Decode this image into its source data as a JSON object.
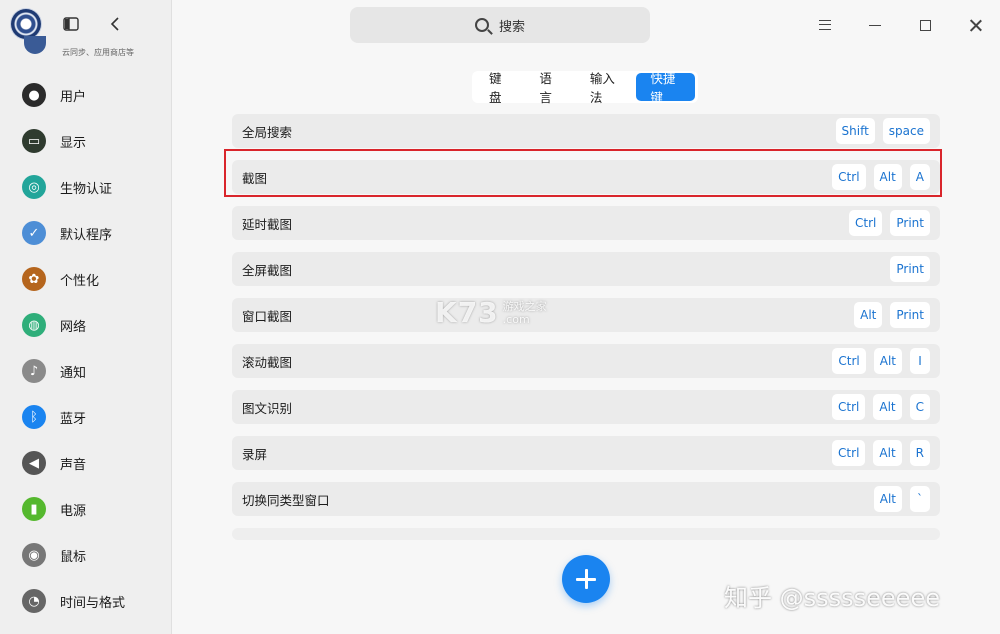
{
  "window": {
    "search_label": "搜索"
  },
  "sidebar": {
    "sync_caption": "云同步、应用商店等",
    "items": [
      {
        "label": "用户",
        "icon": "user-icon",
        "color": "#2b2b2b"
      },
      {
        "label": "显示",
        "icon": "monitor-icon",
        "color": "#2f3b2f"
      },
      {
        "label": "生物认证",
        "icon": "fingerprint-icon",
        "color": "#22a59a"
      },
      {
        "label": "默认程序",
        "icon": "default-apps-icon",
        "color": "#4d8ed6"
      },
      {
        "label": "个性化",
        "icon": "palette-icon",
        "color": "#b5651d"
      },
      {
        "label": "网络",
        "icon": "globe-icon",
        "color": "#2fae7a"
      },
      {
        "label": "通知",
        "icon": "bell-icon",
        "color": "#8a8a8a"
      },
      {
        "label": "蓝牙",
        "icon": "bluetooth-icon",
        "color": "#1a84f0"
      },
      {
        "label": "声音",
        "icon": "speaker-icon",
        "color": "#555555"
      },
      {
        "label": "电源",
        "icon": "battery-icon",
        "color": "#55b82e"
      },
      {
        "label": "鼠标",
        "icon": "mouse-icon",
        "color": "#777777"
      },
      {
        "label": "时间与格式",
        "icon": "clock-icon",
        "color": "#666666"
      }
    ]
  },
  "tabs": [
    {
      "label": "键盘",
      "active": false
    },
    {
      "label": "语言",
      "active": false
    },
    {
      "label": "输入法",
      "active": false
    },
    {
      "label": "快捷键",
      "active": true
    }
  ],
  "shortcuts": [
    {
      "label": "全局搜索",
      "keys": [
        "Shift",
        "space"
      ]
    },
    {
      "label": "截图",
      "keys": [
        "Ctrl",
        "Alt",
        "A"
      ]
    },
    {
      "label": "延时截图",
      "keys": [
        "Ctrl",
        "Print"
      ]
    },
    {
      "label": "全屏截图",
      "keys": [
        "Print"
      ]
    },
    {
      "label": "窗口截图",
      "keys": [
        "Alt",
        "Print"
      ]
    },
    {
      "label": "滚动截图",
      "keys": [
        "Ctrl",
        "Alt",
        "I"
      ]
    },
    {
      "label": "图文识别",
      "keys": [
        "Ctrl",
        "Alt",
        "C"
      ]
    },
    {
      "label": "录屏",
      "keys": [
        "Ctrl",
        "Alt",
        "R"
      ]
    },
    {
      "label": "切换同类型窗口",
      "keys": [
        "Alt",
        "`"
      ]
    }
  ],
  "watermarks": {
    "center_logo": "K73",
    "center_sub": "游戏之家",
    "center_domain": ".com",
    "corner": "知乎 @ssssseeeee"
  },
  "colors": {
    "accent": "#1a84f0",
    "highlight": "#d9252b"
  }
}
